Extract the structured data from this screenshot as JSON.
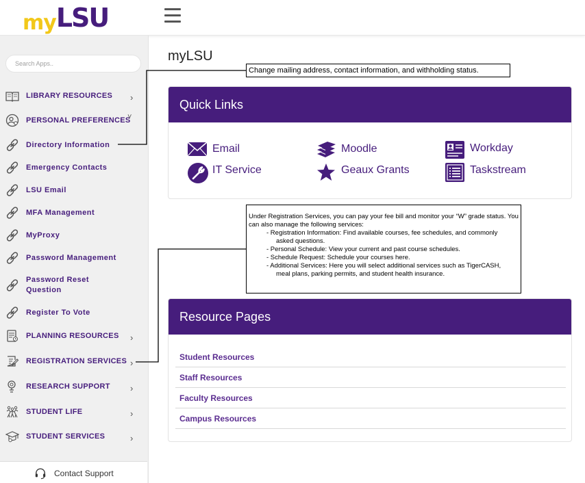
{
  "header": {
    "logo_my": "my",
    "logo_lsu": "LSU",
    "menu_icon": "hamburger-icon"
  },
  "sidebar": {
    "search_placeholder": "Search Apps..",
    "items": [
      {
        "label": "LIBRARY RESOURCES",
        "icon": "book-icon",
        "chevron": "›"
      },
      {
        "label": "PERSONAL PREFERENCES",
        "icon": "person-settings-icon",
        "chevron": "˅"
      },
      {
        "label": "Directory Information",
        "icon": "link-icon"
      },
      {
        "label": "Emergency Contacts",
        "icon": "link-icon"
      },
      {
        "label": "LSU Email",
        "icon": "link-icon"
      },
      {
        "label": "MFA Management",
        "icon": "link-icon"
      },
      {
        "label": "MyProxy",
        "icon": "link-icon"
      },
      {
        "label": "Password Management",
        "icon": "link-icon"
      },
      {
        "label": "Password Reset Question",
        "icon": "link-icon"
      },
      {
        "label": "Register To Vote",
        "icon": "link-icon"
      },
      {
        "label": "PLANNING RESOURCES",
        "icon": "planning-icon",
        "chevron": "›"
      },
      {
        "label": "REGISTRATION SERVICES",
        "icon": "registration-icon",
        "chevron": "›"
      },
      {
        "label": "RESEARCH SUPPORT",
        "icon": "research-icon",
        "chevron": "›"
      },
      {
        "label": "STUDENT LIFE",
        "icon": "student-life-icon",
        "chevron": "›"
      },
      {
        "label": "STUDENT SERVICES",
        "icon": "graduation-cap-icon",
        "chevron": "›"
      }
    ],
    "support_label": "Contact Support"
  },
  "main": {
    "title": "myLSU",
    "quick_links": {
      "heading": "Quick Links",
      "items": [
        {
          "label": "Email",
          "icon": "envelope-icon"
        },
        {
          "label": "Moodle",
          "icon": "books-stack-icon"
        },
        {
          "label": "Workday",
          "icon": "id-card-icon"
        },
        {
          "label": "IT Service",
          "icon": "wrench-icon"
        },
        {
          "label": "Geaux Grants",
          "icon": "star-icon"
        },
        {
          "label": "Taskstream",
          "icon": "list-icon"
        }
      ]
    },
    "resource_pages": {
      "heading": "Resource Pages",
      "items": [
        "Student Resources",
        "Staff Resources",
        "Faculty Resources",
        "Campus Resources"
      ]
    }
  },
  "callouts": {
    "personal": "Change mailing address, contact information, and withholding status.",
    "registration_intro": "Under Registration Services, you can pay your fee bill and monitor your “W” grade status. You can also manage the following services:",
    "registration_items": [
      "- Registration Information: Find available courses, fee schedules, and commonly",
      "asked questions.",
      "- Personal Schedule: View your current and past course schedules.",
      "- Schedule Request: Schedule your courses here.",
      "- Additional Services: Here you will select additional services such as TigerCASH,",
      "meal plans, parking permits, and student health insurance."
    ]
  },
  "colors": {
    "brand_purple": "#461d7c",
    "brand_gold": "#f2c81a",
    "sidebar_bg": "#f0f0f0"
  }
}
